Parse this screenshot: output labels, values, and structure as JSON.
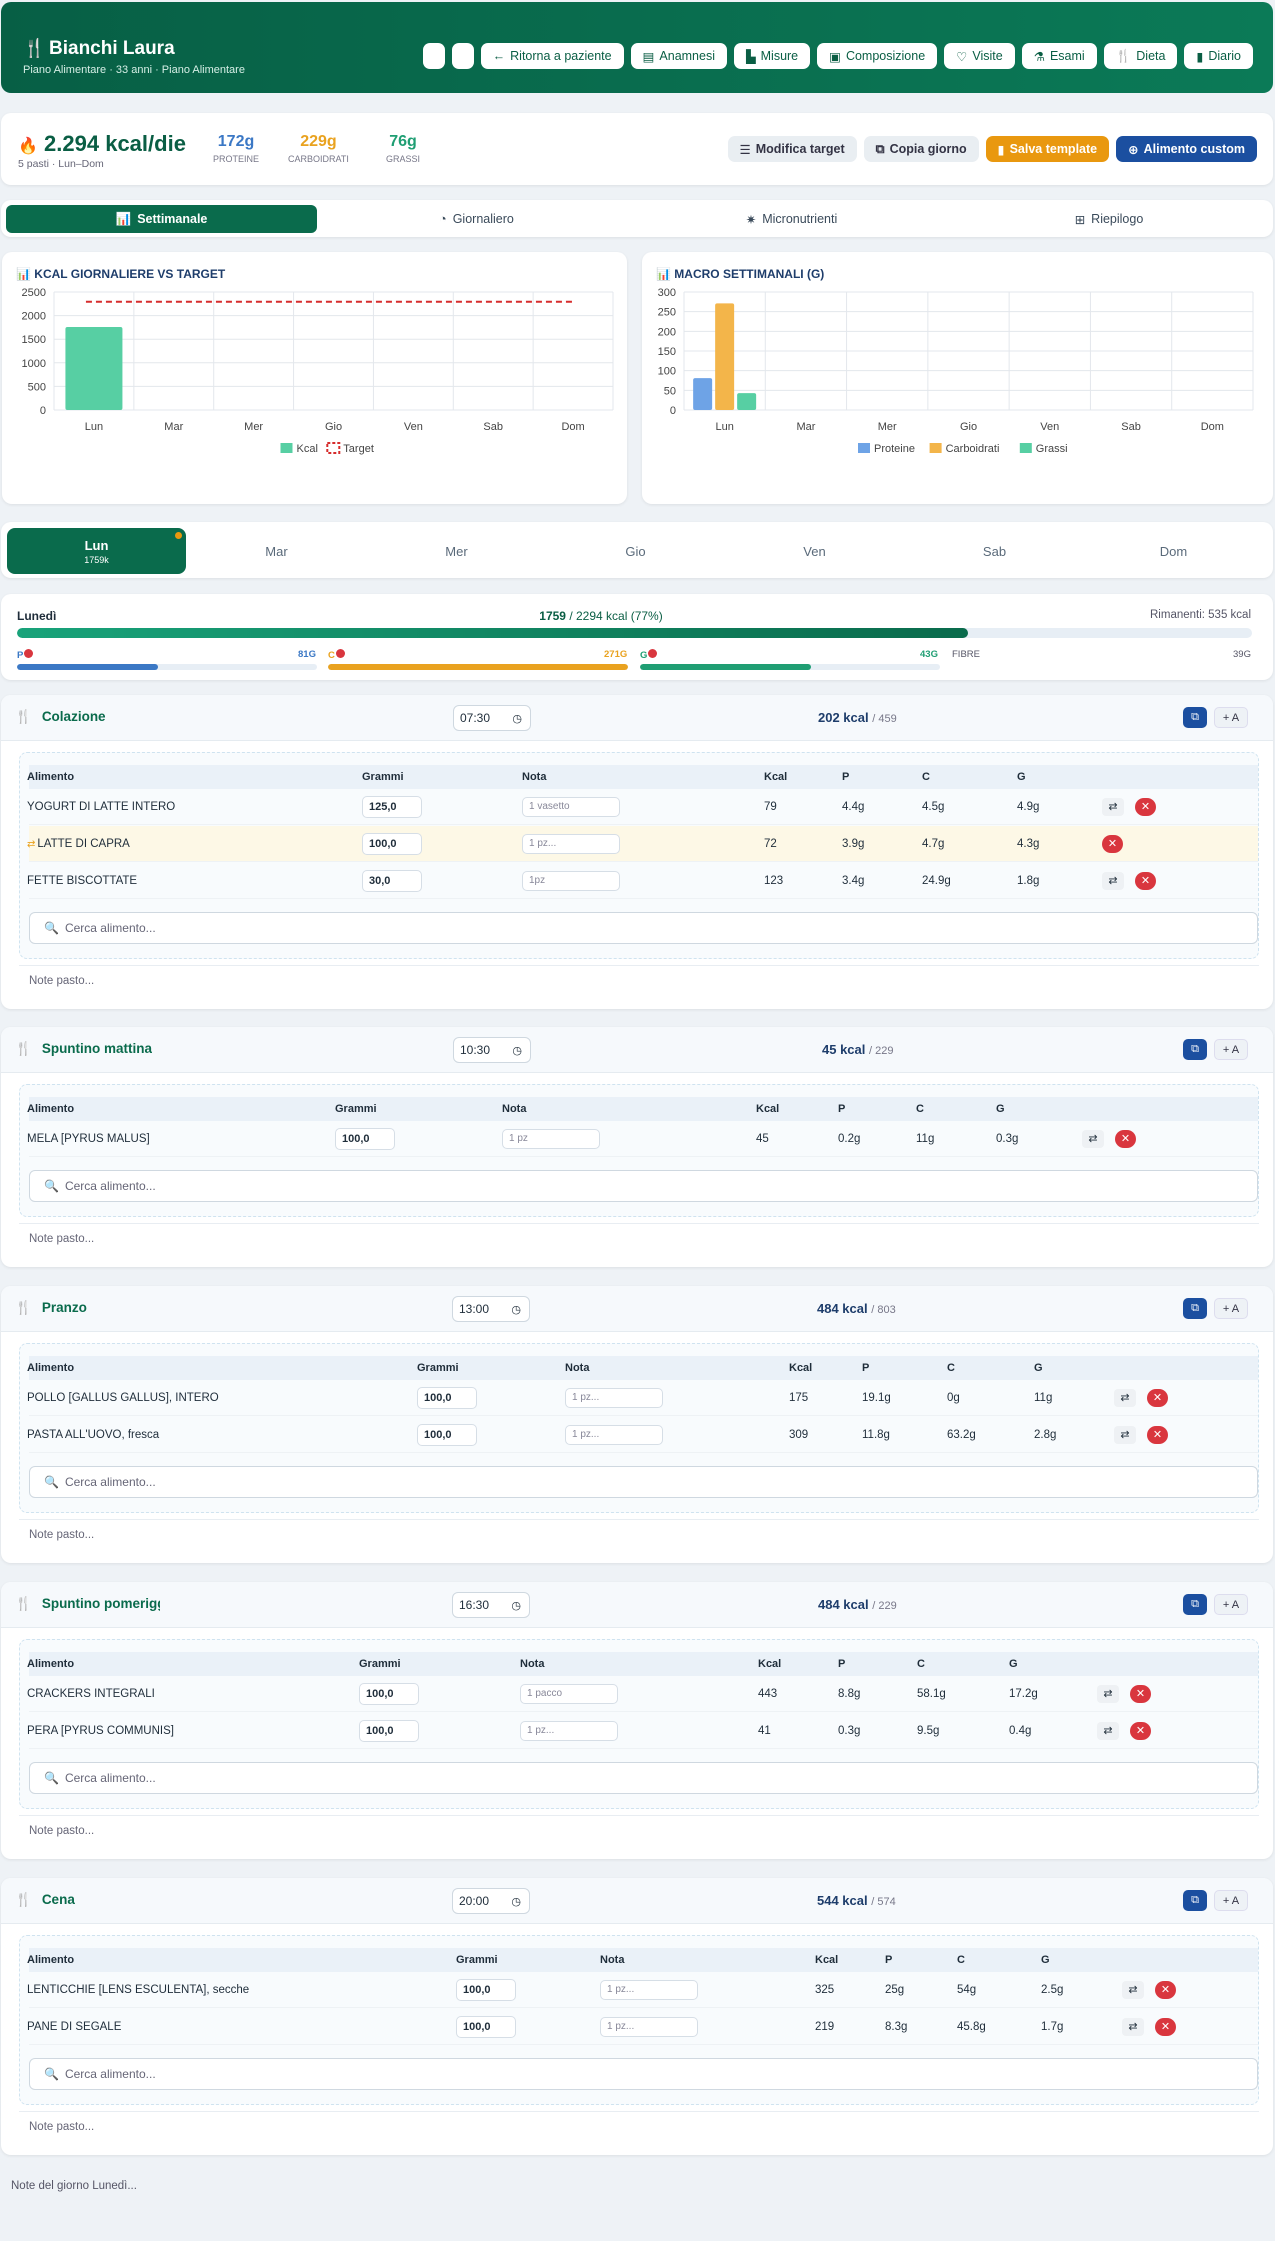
{
  "header": {
    "icon": "fork-knife-icon",
    "patient_name": "Bianchi Laura",
    "subtitle": "Piano Alimentare · 33 anni · Piano Alimentare",
    "buttons": [
      {
        "label": "Ritorna a paziente",
        "icon": "arrow-left-icon"
      },
      {
        "label": "Anamnesi",
        "icon": "clipboard-icon"
      },
      {
        "label": "Misure",
        "icon": "ruler-icon"
      },
      {
        "label": "Composizione",
        "icon": "scale-icon"
      },
      {
        "label": "Visite",
        "icon": "stethoscope-icon"
      },
      {
        "label": "Esami",
        "icon": "flask-icon"
      },
      {
        "label": "Dieta",
        "icon": "fork-knife-icon"
      },
      {
        "label": "Diario",
        "icon": "book-icon"
      }
    ]
  },
  "summary": {
    "kcal": "2.294 kcal/die",
    "meta": "5 pasti · Lun–Dom",
    "proteine": {
      "value": "172g",
      "label": "PROTEINE",
      "color": "#3b78c5"
    },
    "carboidrati": {
      "value": "229g",
      "label": "CARBOIDRATI",
      "color": "#e9a21f"
    },
    "grassi": {
      "value": "76g",
      "label": "GRASSI",
      "color": "#1f9e73"
    },
    "buttons": {
      "modifica": "Modifica target",
      "copia": "Copia giorno",
      "salva": "Salva template",
      "custom": "Alimento custom"
    }
  },
  "view_tabs": [
    {
      "label": "Settimanale",
      "icon": "bar-chart-icon",
      "active": true
    },
    {
      "label": "Giornaliero",
      "icon": "pie-chart-icon"
    },
    {
      "label": "Micronutrienti",
      "icon": "atom-icon"
    },
    {
      "label": "Riepilogo",
      "icon": "table-icon"
    }
  ],
  "chart_data": [
    {
      "type": "bar",
      "title": "KCAL GIORNALIERE VS TARGET",
      "categories": [
        "Lun",
        "Mar",
        "Mer",
        "Gio",
        "Ven",
        "Sab",
        "Dom"
      ],
      "series": [
        {
          "name": "Kcal",
          "values": [
            1759,
            0,
            0,
            0,
            0,
            0,
            0
          ],
          "color": "#57cfa3"
        },
        {
          "name": "Target",
          "type": "line",
          "values": [
            2294,
            2294,
            2294,
            2294,
            2294,
            2294,
            2294
          ],
          "color": "#d62c2c"
        }
      ],
      "ylim": [
        0,
        2500
      ],
      "yticks": [
        0,
        500,
        1000,
        1500,
        2000,
        2500
      ],
      "legend": "bottom"
    },
    {
      "type": "bar",
      "title": "MACRO SETTIMANALI (G)",
      "categories": [
        "Lun",
        "Mar",
        "Mer",
        "Gio",
        "Ven",
        "Sab",
        "Dom"
      ],
      "series": [
        {
          "name": "Proteine",
          "values": [
            81,
            0,
            0,
            0,
            0,
            0,
            0
          ],
          "color": "#6ea3e6"
        },
        {
          "name": "Carboidrati",
          "values": [
            271,
            0,
            0,
            0,
            0,
            0,
            0
          ],
          "color": "#f3b54a"
        },
        {
          "name": "Grassi",
          "values": [
            43,
            0,
            0,
            0,
            0,
            0,
            0
          ],
          "color": "#57cfa3"
        }
      ],
      "ylim": [
        0,
        300
      ],
      "yticks": [
        0,
        50,
        100,
        150,
        200,
        250,
        300
      ],
      "legend": "bottom"
    }
  ],
  "day_tabs": [
    {
      "label": "Lun",
      "kcal": "1759k",
      "active": true
    },
    {
      "label": "Mar"
    },
    {
      "label": "Mer"
    },
    {
      "label": "Gio"
    },
    {
      "label": "Ven"
    },
    {
      "label": "Sab"
    },
    {
      "label": "Dom"
    }
  ],
  "day": {
    "name": "Lunedì",
    "kcal_current": "1759",
    "kcal_rest": "/ 2294 kcal (77%)",
    "progress": 0.77,
    "remaining": "Rimanenti: 535 kcal",
    "p": {
      "label": "P",
      "value": "81G",
      "fill": 0.47
    },
    "c": {
      "label": "C",
      "value": "271G",
      "fill": 1.0
    },
    "g": {
      "label": "G",
      "value": "43G",
      "fill": 0.57
    },
    "fibre": {
      "label": "FIBRE",
      "value": "39G"
    }
  },
  "table_headers": {
    "alimento": "Alimento",
    "grammi": "Grammi",
    "nota": "Nota",
    "kcal": "Kcal",
    "p": "P",
    "c": "C",
    "g": "G"
  },
  "search_placeholder": "Cerca alimento...",
  "note_placeholder": "Note pasto...",
  "meals": [
    {
      "name": "Colazione",
      "time": "07:30",
      "kcal": "202 kcal",
      "target": "/ 459",
      "rows": [
        {
          "food": "YOGURT DI LATTE INTERO",
          "grams": "125,0",
          "note": "1 vasetto",
          "kcal": "79",
          "p": "4.4g",
          "c": "4.5g",
          "g": "4.9g"
        },
        {
          "food": "LATTE DI CAPRA",
          "grams": "100,0",
          "note": "1 pz...",
          "kcal": "72",
          "p": "3.9g",
          "c": "4.7g",
          "g": "4.3g",
          "highlight": true
        },
        {
          "food": "FETTE BISCOTTATE",
          "grams": "30,0",
          "note": "1pz",
          "kcal": "123",
          "p": "3.4g",
          "c": "24.9g",
          "g": "1.8g"
        }
      ]
    },
    {
      "name": "Spuntino mattina",
      "time": "10:30",
      "kcal": "45 kcal",
      "target": "/ 229",
      "rows": [
        {
          "food": "MELA [PYRUS MALUS]",
          "grams": "100,0",
          "note": "1 pz",
          "kcal": "45",
          "p": "0.2g",
          "c": "11g",
          "g": "0.3g"
        }
      ]
    },
    {
      "name": "Pranzo",
      "time": "13:00",
      "kcal": "484 kcal",
      "target": "/ 803",
      "rows": [
        {
          "food": "POLLO [GALLUS GALLUS], INTERO",
          "grams": "100,0",
          "note": "1 pz...",
          "kcal": "175",
          "p": "19.1g",
          "c": "0g",
          "g": "11g"
        },
        {
          "food": "PASTA ALL'UOVO, fresca",
          "grams": "100,0",
          "note": "1 pz...",
          "kcal": "309",
          "p": "11.8g",
          "c": "63.2g",
          "g": "2.8g"
        }
      ]
    },
    {
      "name": "Spuntino pomeriggio",
      "time": "16:30",
      "kcal": "484 kcal",
      "target": "/ 229",
      "rows": [
        {
          "food": "CRACKERS INTEGRALI",
          "grams": "100,0",
          "note": "1 pacco",
          "kcal": "443",
          "p": "8.8g",
          "c": "58.1g",
          "g": "17.2g"
        },
        {
          "food": "PERA [PYRUS COMMUNIS]",
          "grams": "100,0",
          "note": "1 pz...",
          "kcal": "41",
          "p": "0.3g",
          "c": "9.5g",
          "g": "0.4g"
        }
      ]
    },
    {
      "name": "Cena",
      "time": "20:00",
      "kcal": "544 kcal",
      "target": "/ 574",
      "rows": [
        {
          "food": "LENTICCHIE [LENS ESCULENTA], secche",
          "grams": "100,0",
          "note": "1 pz...",
          "kcal": "325",
          "p": "25g",
          "c": "54g",
          "g": "2.5g"
        },
        {
          "food": "PANE DI SEGALE",
          "grams": "100,0",
          "note": "1 pz...",
          "kcal": "219",
          "p": "8.3g",
          "c": "45.8g",
          "g": "1.7g"
        }
      ]
    }
  ],
  "day_note": "Note del giorno Lunedì..."
}
